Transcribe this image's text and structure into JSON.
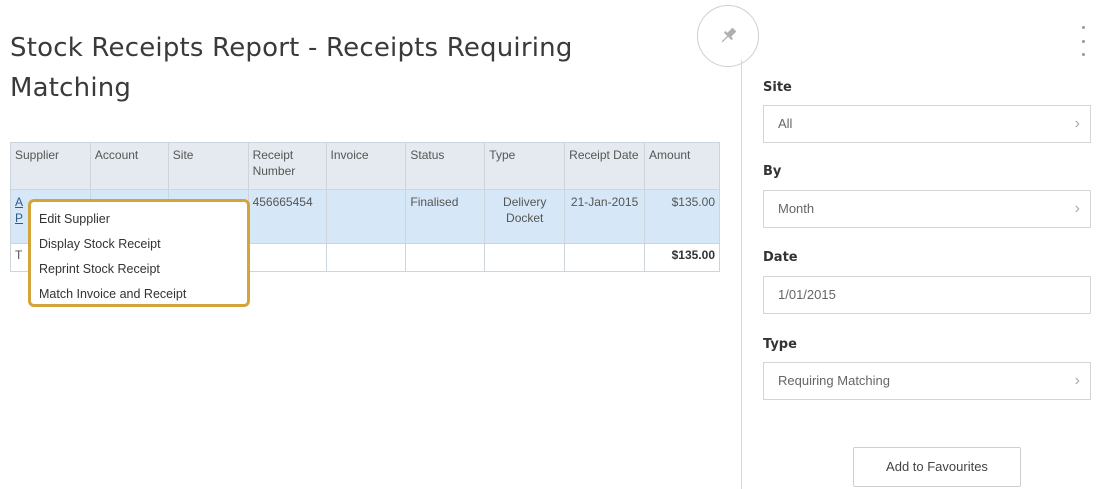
{
  "page": {
    "title": "Stock Receipts Report - Receipts Requiring Matching"
  },
  "icons": {
    "pin": "pin-icon",
    "menu": "kebab-menu-icon",
    "chevron": "chevron-right-icon"
  },
  "colors": {
    "header_bg": "#e4eaf0",
    "selected_row_bg": "#d6e8f7",
    "context_menu_border": "#d4a43a"
  },
  "table": {
    "headers": [
      "Supplier",
      "Account",
      "Site",
      "Receipt Number",
      "Invoice",
      "Status",
      "Type",
      "Receipt Date",
      "Amount"
    ],
    "row": {
      "supplier_partial_top": "A",
      "supplier_partial_bottom": "P",
      "receipt_number": "456665454",
      "status": "Finalised",
      "type": "Delivery Docket",
      "receipt_date": "21-Jan-2015",
      "amount": "$135.00"
    },
    "total": {
      "label_partial": "T",
      "amount": "$135.00"
    }
  },
  "context_menu": {
    "items": [
      "Edit Supplier",
      "Display Stock Receipt",
      "Reprint Stock Receipt",
      "Match Invoice and Receipt"
    ]
  },
  "panel": {
    "site_label": "Site",
    "site_value": "All",
    "by_label": "By",
    "by_value": "Month",
    "date_label": "Date",
    "date_value": "1/01/2015",
    "type_label": "Type",
    "type_value": "Requiring Matching",
    "add_favourites": "Add to Favourites"
  }
}
